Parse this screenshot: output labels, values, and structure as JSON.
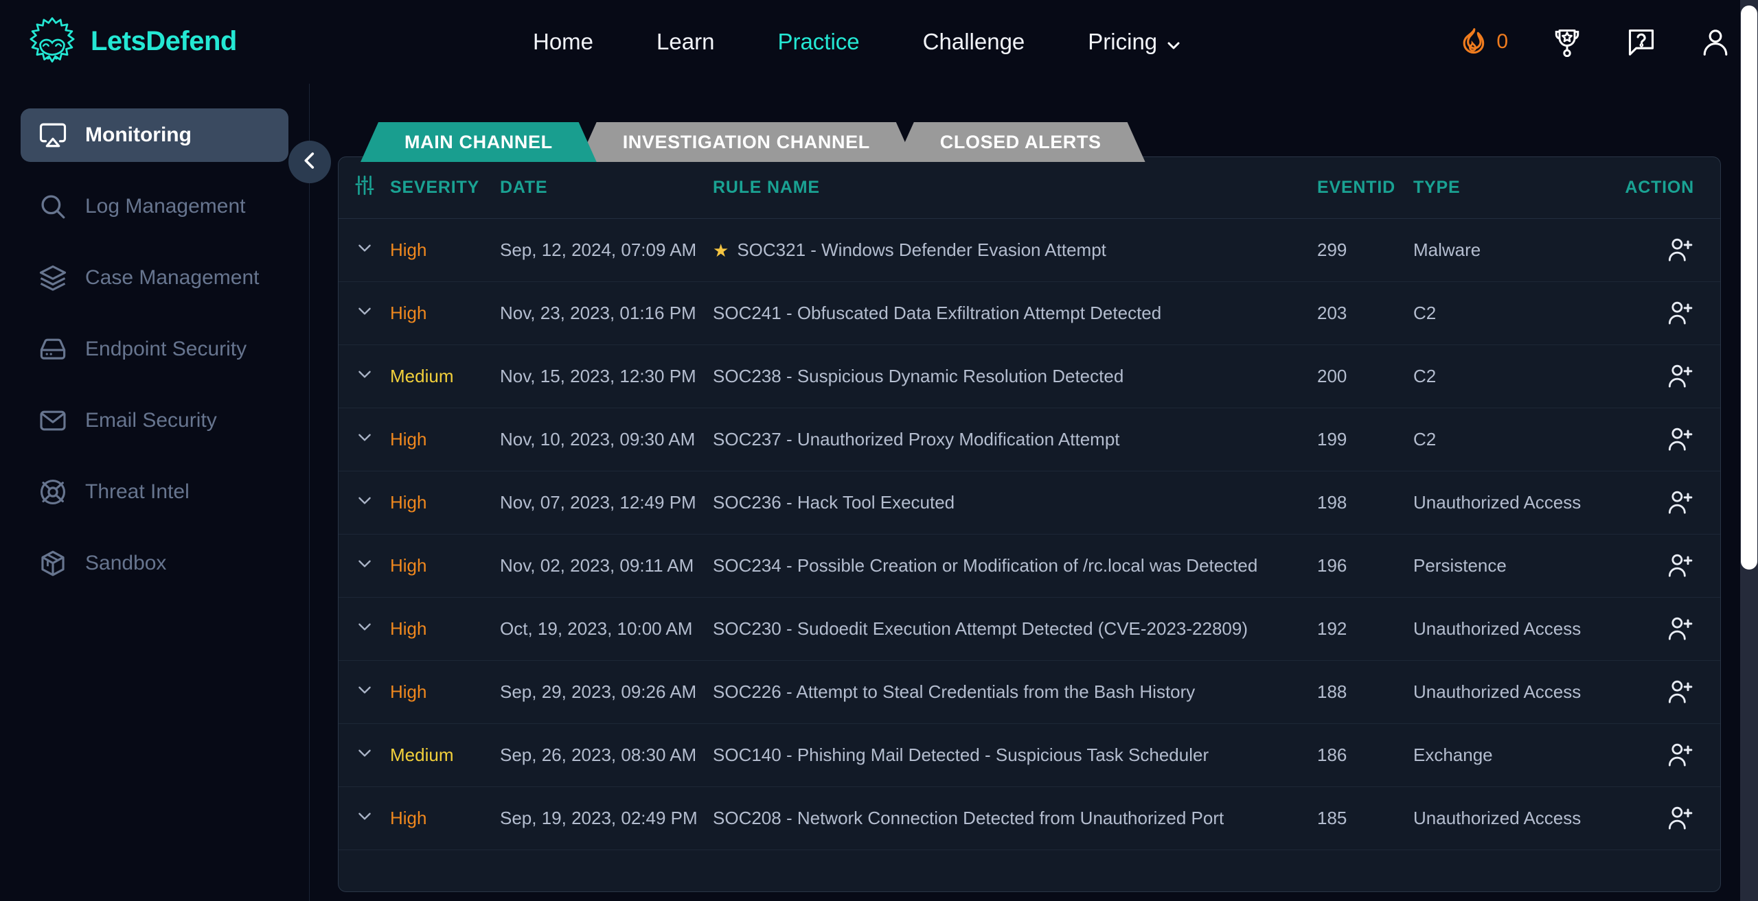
{
  "brand": {
    "name": "LetsDefend",
    "logo_icon": "letsdefend-mascot-logo",
    "color": "#24e8d4"
  },
  "topnav": {
    "items": [
      {
        "label": "Home",
        "active": false
      },
      {
        "label": "Learn",
        "active": false
      },
      {
        "label": "Practice",
        "active": true
      },
      {
        "label": "Challenge",
        "active": false
      },
      {
        "label": "Pricing",
        "active": false,
        "has_dropdown": true
      }
    ],
    "right": {
      "streak_icon": "fire-icon",
      "streak_count": "0",
      "streak_color": "#f07c1e",
      "trophy_icon": "trophy-star-icon",
      "help_icon": "question-speech-bubble-icon",
      "account_icon": "user-account-icon"
    }
  },
  "sidebar": {
    "collapse_icon": "chevron-left-icon",
    "items": [
      {
        "label": "Monitoring",
        "icon": "monitor-airplay-icon",
        "active": true
      },
      {
        "label": "Log Management",
        "icon": "search-icon",
        "active": false
      },
      {
        "label": "Case Management",
        "icon": "layers-icon",
        "active": false
      },
      {
        "label": "Endpoint Security",
        "icon": "server-icon",
        "active": false
      },
      {
        "label": "Email Security",
        "icon": "envelope-icon",
        "active": false
      },
      {
        "label": "Threat Intel",
        "icon": "target-crosshair-icon",
        "active": false
      },
      {
        "label": "Sandbox",
        "icon": "cube-box-icon",
        "active": false
      }
    ]
  },
  "tabs": [
    {
      "label": "MAIN CHANNEL",
      "active": true,
      "color": "#199e8f"
    },
    {
      "label": "INVESTIGATION CHANNEL",
      "active": false,
      "color": "#9a9a9a"
    },
    {
      "label": "CLOSED ALERTS",
      "active": false,
      "color": "#9a9a9a"
    }
  ],
  "table": {
    "filter_icon": "sliders-filter-icon",
    "headers": {
      "severity": "SEVERITY",
      "date": "DATE",
      "rule_name": "RULE NAME",
      "eventid": "EVENTID",
      "type": "TYPE",
      "action": "ACTION"
    },
    "header_color": "#1aa293",
    "severity_colors": {
      "High": "#f0881e",
      "Medium": "#f2d03b"
    },
    "action_icon": "add-user-assign-icon",
    "expand_icon": "chevron-down-icon",
    "rows": [
      {
        "severity": "High",
        "date": "Sep, 12, 2024, 07:09 AM",
        "rule": "SOC321 - Windows Defender Evasion Attempt",
        "eventid": "299",
        "type": "Malware",
        "starred": true
      },
      {
        "severity": "High",
        "date": "Nov, 23, 2023, 01:16 PM",
        "rule": "SOC241 - Obfuscated Data Exfiltration Attempt Detected",
        "eventid": "203",
        "type": "C2",
        "starred": false
      },
      {
        "severity": "Medium",
        "date": "Nov, 15, 2023, 12:30 PM",
        "rule": "SOC238 - Suspicious Dynamic Resolution Detected",
        "eventid": "200",
        "type": "C2",
        "starred": false
      },
      {
        "severity": "High",
        "date": "Nov, 10, 2023, 09:30 AM",
        "rule": "SOC237 - Unauthorized Proxy Modification Attempt",
        "eventid": "199",
        "type": "C2",
        "starred": false
      },
      {
        "severity": "High",
        "date": "Nov, 07, 2023, 12:49 PM",
        "rule": "SOC236 - Hack Tool Executed",
        "eventid": "198",
        "type": "Unauthorized Access",
        "starred": false
      },
      {
        "severity": "High",
        "date": "Nov, 02, 2023, 09:11 AM",
        "rule": "SOC234 - Possible Creation or Modification of /rc.local was Detected",
        "eventid": "196",
        "type": "Persistence",
        "starred": false
      },
      {
        "severity": "High",
        "date": "Oct, 19, 2023, 10:00 AM",
        "rule": "SOC230 - Sudoedit Execution Attempt Detected (CVE-2023-22809)",
        "eventid": "192",
        "type": "Unauthorized Access",
        "starred": false
      },
      {
        "severity": "High",
        "date": "Sep, 29, 2023, 09:26 AM",
        "rule": "SOC226 - Attempt to Steal Credentials from the Bash History",
        "eventid": "188",
        "type": "Unauthorized Access",
        "starred": false
      },
      {
        "severity": "Medium",
        "date": "Sep, 26, 2023, 08:30 AM",
        "rule": "SOC140 - Phishing Mail Detected - Suspicious Task Scheduler",
        "eventid": "186",
        "type": "Exchange",
        "starred": false
      },
      {
        "severity": "High",
        "date": "Sep, 19, 2023, 02:49 PM",
        "rule": "SOC208 - Network Connection Detected from Unauthorized Port",
        "eventid": "185",
        "type": "Unauthorized Access",
        "starred": false
      }
    ]
  },
  "theme": {
    "bg": "#070a16",
    "panel_bg": "#121a27",
    "accent": "#24e8d4",
    "teal": "#1aa293"
  }
}
